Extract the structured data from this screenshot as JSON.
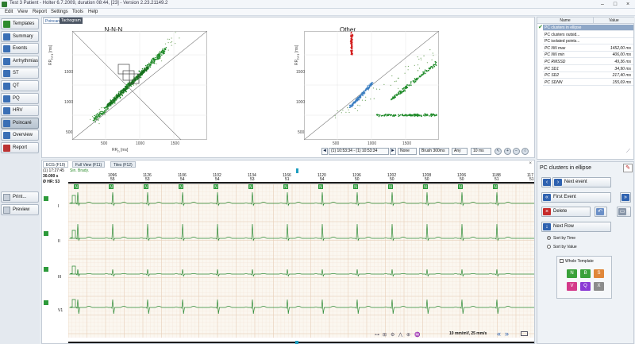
{
  "window": {
    "title": "Test 3 Patient - Holter 6.7.2009, duration 08:44, [23] - Version 2.23.21149.2",
    "min_glyph": "–",
    "max_glyph": "□",
    "close_glyph": "×"
  },
  "menu": [
    "Edit",
    "View",
    "Report",
    "Settings",
    "Tools",
    "Help"
  ],
  "nav": {
    "items": [
      {
        "label": "Templates",
        "color": "#2e8b2e"
      },
      {
        "label": "Summary",
        "color": "#3a6fb5"
      },
      {
        "label": "Events",
        "color": "#3a6fb5"
      },
      {
        "label": "Arrhythmias",
        "color": "#3a6fb5"
      },
      {
        "label": "ST",
        "color": "#3a6fb5"
      },
      {
        "label": "QT",
        "color": "#3a6fb5"
      },
      {
        "label": "PQ",
        "color": "#3a6fb5"
      },
      {
        "label": "HRV",
        "color": "#3a6fb5"
      },
      {
        "label": "Poincaré",
        "color": "#3a6fb5"
      },
      {
        "label": "Overview",
        "color": "#3a6fb5"
      },
      {
        "label": "Report",
        "color": "#b33"
      }
    ],
    "active_index": 8,
    "print_label": "Print...",
    "preview_label": "Preview"
  },
  "poincare": {
    "tabs": [
      "Poincaré",
      "Tachogram"
    ],
    "plot_left_title": "N-N-N",
    "plot_right_title": "Other",
    "x_label": "RR",
    "x_label_sub": "n",
    "x_label_unit": "[ms]",
    "y_label": "RR",
    "y_label_sub": "n+1",
    "y_label_unit": "[ms]",
    "ticks": [
      "500",
      "1000",
      "1500"
    ],
    "toolbar": {
      "range": "(1) 10:53:34 - (1) 10:53:34",
      "filter": "None",
      "brush": "Brush 300ms",
      "mode": "Any",
      "step": "10 ms",
      "prev": "◄",
      "next": "►"
    }
  },
  "stats": {
    "col_name": "Name",
    "col_value": "Value",
    "rows": [
      {
        "name": "PC clusters in ellipse",
        "value": "",
        "group": true,
        "selected": true
      },
      {
        "name": "PC clusters outsid...",
        "value": "",
        "group": true,
        "selected": false
      },
      {
        "name": "PC isolated points...",
        "value": "",
        "group": true,
        "selected": false
      },
      {
        "name": "PC NN max",
        "value": "1452,00 ms",
        "group": false,
        "selected": false
      },
      {
        "name": "PC NN min",
        "value": "406,00 ms",
        "group": false,
        "selected": false
      },
      {
        "name": "PC RMSSD",
        "value": "49,36 ms",
        "group": false,
        "selected": false
      },
      {
        "name": "PC SD1",
        "value": "34,90 ms",
        "group": false,
        "selected": false
      },
      {
        "name": "PC SD2",
        "value": "217,40 ms",
        "group": false,
        "selected": false
      },
      {
        "name": "PC SDNN",
        "value": "155,69 ms",
        "group": false,
        "selected": false
      }
    ]
  },
  "ecg": {
    "tabs": [
      "ECG (F10)",
      "Full View (F11)",
      "Tiles (F12)"
    ],
    "time": "(1) 17:27:45",
    "duration": "30.000 s",
    "hr": "Ø HR: 53",
    "rhythm": "Sin. Brady.",
    "rr_values": [
      "1096",
      "1126",
      "1106",
      "1102",
      "1134",
      "1166",
      "1120",
      "1196",
      "1202",
      "1208",
      "1206",
      "1188",
      "117"
    ],
    "hr_values": [
      "55",
      "53",
      "54",
      "54",
      "53",
      "51",
      "54",
      "50",
      "50",
      "50",
      "50",
      "51",
      "51"
    ],
    "beat_label": "N",
    "leads": [
      "I",
      "II",
      "III",
      "V1"
    ],
    "scale": "10 mm/mV, 25 mm/s",
    "pager_left": "«",
    "pager_right": "»"
  },
  "control": {
    "title": "PC clusters in ellipse",
    "next_event": "Next event",
    "first_event": "First Event",
    "delete": "Delete",
    "next_row": "Next Row",
    "sort_time": "Sort by Time",
    "sort_value": "Sort by Value",
    "whole_template": "Whole Template",
    "templates": [
      {
        "label": "N",
        "color": "#3aa13a"
      },
      {
        "label": "B",
        "color": "#3aa13a"
      },
      {
        "label": "S",
        "color": "#e0873a"
      },
      {
        "label": "V",
        "color": "#d43a8a"
      },
      {
        "label": "Q",
        "color": "#8a3ad4"
      },
      {
        "label": "X",
        "color": "#8c8c8c"
      }
    ]
  }
}
